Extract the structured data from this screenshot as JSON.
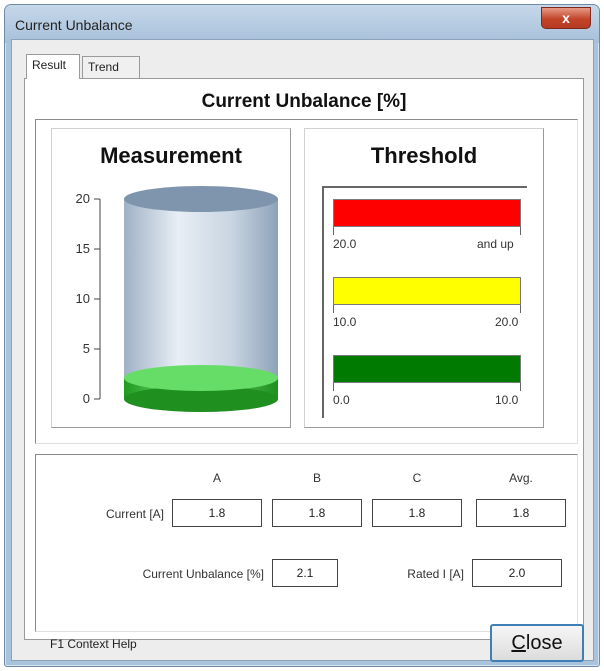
{
  "window": {
    "title": "Current Unbalance",
    "close_glyph": "x"
  },
  "tabs": [
    {
      "label": "Result",
      "active": true
    },
    {
      "label": "Trend",
      "active": false
    }
  ],
  "panel_title": "Current Unbalance [%]",
  "measurement": {
    "heading": "Measurement",
    "axis_ticks": [
      "20",
      "15",
      "10",
      "5",
      "0"
    ],
    "axis_max": 20,
    "value": 2.1,
    "fill_color": "#3cc43c"
  },
  "threshold": {
    "heading": "Threshold",
    "bands": [
      {
        "color": "#ff0000",
        "low": "20.0",
        "high": "and up"
      },
      {
        "color": "#ffff00",
        "low": "10.0",
        "high": "20.0"
      },
      {
        "color": "#007a00",
        "low": "0.0",
        "high": "10.0"
      }
    ]
  },
  "values": {
    "columns": [
      "A",
      "B",
      "C",
      "Avg."
    ],
    "current_label": "Current [A]",
    "current": [
      "1.8",
      "1.8",
      "1.8",
      "1.8"
    ],
    "unbalance_label": "Current Unbalance [%]",
    "unbalance": "2.1",
    "rated_label": "Rated I [A]",
    "rated": "2.0"
  },
  "footer": {
    "help_text": "F1 Context Help",
    "close_label_first": "C",
    "close_label_rest": "lose"
  }
}
